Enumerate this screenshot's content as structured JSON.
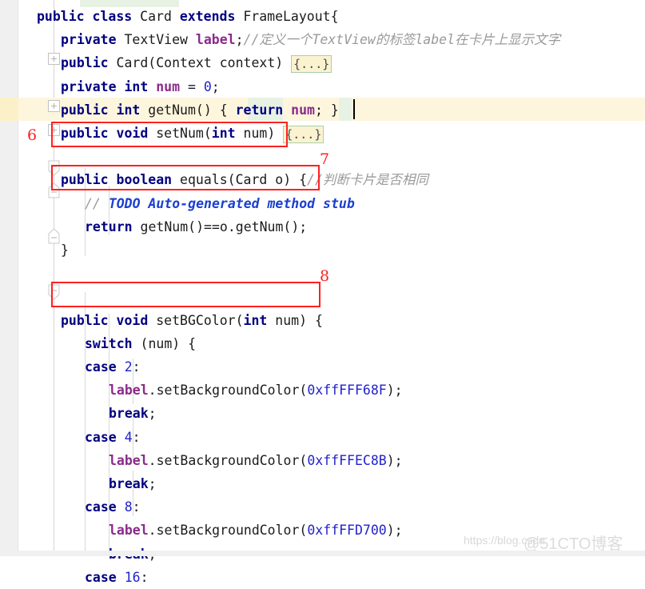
{
  "editor": {
    "language": "java",
    "class_name": "Card",
    "colors": {
      "keyword": "#000080",
      "field": "#8a2b8a",
      "number": "#2222cc",
      "comment": "#9a9a9a",
      "todo": "#1a3fd0",
      "annotation": "#ff2020",
      "current_line": "#fdf6dd",
      "fold_chip_bg": "#fbf3d0",
      "fold_chip_border": "#a8cdb0",
      "green_highlight": "#e8f2e4"
    }
  },
  "code_lines": [
    {
      "id": "line-class-decl",
      "indent": 0,
      "tokens": [
        {
          "t": "public",
          "c": "kw"
        },
        {
          "t": " ",
          "c": "punc"
        },
        {
          "t": "class",
          "c": "kw"
        },
        {
          "t": " ",
          "c": "punc"
        },
        {
          "t": "Card",
          "c": "ident"
        },
        {
          "t": " ",
          "c": "punc"
        },
        {
          "t": "extends",
          "c": "kw"
        },
        {
          "t": " ",
          "c": "punc"
        },
        {
          "t": "FrameLayout",
          "c": "ident"
        },
        {
          "t": "{",
          "c": "punc"
        }
      ]
    },
    {
      "id": "line-field-label",
      "indent": 1,
      "tokens": [
        {
          "t": "private",
          "c": "kw"
        },
        {
          "t": " ",
          "c": "punc"
        },
        {
          "t": "TextView",
          "c": "ident"
        },
        {
          "t": " ",
          "c": "punc"
        },
        {
          "t": "label",
          "c": "fld"
        },
        {
          "t": ";",
          "c": "punc"
        },
        {
          "t": "//定义一个TextView的标签label在卡片上显示文字",
          "c": "cmt"
        }
      ]
    },
    {
      "id": "line-constructor",
      "indent": 1,
      "tokens": [
        {
          "t": "public",
          "c": "kw"
        },
        {
          "t": " ",
          "c": "punc"
        },
        {
          "t": "Card",
          "c": "ident"
        },
        {
          "t": "(",
          "c": "punc"
        },
        {
          "t": "Context",
          "c": "ident"
        },
        {
          "t": " ",
          "c": "punc"
        },
        {
          "t": "context",
          "c": "ident"
        },
        {
          "t": ") ",
          "c": "punc"
        },
        {
          "t": "{...}",
          "c": "chip"
        }
      ]
    },
    {
      "id": "line-field-num",
      "indent": 1,
      "tokens": [
        {
          "t": "private",
          "c": "kw"
        },
        {
          "t": " ",
          "c": "punc"
        },
        {
          "t": "int",
          "c": "kw"
        },
        {
          "t": " ",
          "c": "punc"
        },
        {
          "t": "num",
          "c": "fld"
        },
        {
          "t": " = ",
          "c": "punc"
        },
        {
          "t": "0",
          "c": "num"
        },
        {
          "t": ";",
          "c": "punc"
        }
      ]
    },
    {
      "id": "line-getnum",
      "indent": 1,
      "tokens": [
        {
          "t": "public",
          "c": "kw"
        },
        {
          "t": " ",
          "c": "punc"
        },
        {
          "t": "int",
          "c": "kw"
        },
        {
          "t": " ",
          "c": "punc"
        },
        {
          "t": "getNum",
          "c": "ident"
        },
        {
          "t": "() ",
          "c": "punc"
        },
        {
          "t": "{ ",
          "c": "punc"
        },
        {
          "t": "return",
          "c": "kw"
        },
        {
          "t": " ",
          "c": "punc"
        },
        {
          "t": "num",
          "c": "fld"
        },
        {
          "t": "; ",
          "c": "punc"
        },
        {
          "t": "}",
          "c": "punc"
        }
      ]
    },
    {
      "id": "line-setnum",
      "indent": 1,
      "tokens": [
        {
          "t": "public",
          "c": "kw"
        },
        {
          "t": " ",
          "c": "punc"
        },
        {
          "t": "void",
          "c": "kw"
        },
        {
          "t": " ",
          "c": "punc"
        },
        {
          "t": "setNum",
          "c": "ident"
        },
        {
          "t": "(",
          "c": "punc"
        },
        {
          "t": "int",
          "c": "kw"
        },
        {
          "t": " ",
          "c": "punc"
        },
        {
          "t": "num",
          "c": "ident"
        },
        {
          "t": ") ",
          "c": "punc"
        },
        {
          "t": "{...}",
          "c": "chip"
        }
      ]
    },
    {
      "id": "line-blank-1",
      "indent": 0,
      "tokens": []
    },
    {
      "id": "line-equals",
      "indent": 1,
      "tokens": [
        {
          "t": "public",
          "c": "kw"
        },
        {
          "t": " ",
          "c": "punc"
        },
        {
          "t": "boolean",
          "c": "kw"
        },
        {
          "t": " ",
          "c": "punc"
        },
        {
          "t": "equals",
          "c": "ident"
        },
        {
          "t": "(",
          "c": "punc"
        },
        {
          "t": "Card",
          "c": "ident"
        },
        {
          "t": " ",
          "c": "punc"
        },
        {
          "t": "o",
          "c": "ident"
        },
        {
          "t": ") {",
          "c": "punc"
        },
        {
          "t": "//判断卡片是否相同",
          "c": "cmt"
        }
      ]
    },
    {
      "id": "line-todo",
      "indent": 2,
      "tokens": [
        {
          "t": "// ",
          "c": "cmt"
        },
        {
          "t": "TODO Auto-generated method stub",
          "c": "todo"
        }
      ]
    },
    {
      "id": "line-return-equals",
      "indent": 2,
      "tokens": [
        {
          "t": "return",
          "c": "kw"
        },
        {
          "t": " ",
          "c": "punc"
        },
        {
          "t": "getNum",
          "c": "ident"
        },
        {
          "t": "()==",
          "c": "punc"
        },
        {
          "t": "o",
          "c": "ident"
        },
        {
          "t": ".",
          "c": "punc"
        },
        {
          "t": "getNum",
          "c": "ident"
        },
        {
          "t": "();",
          "c": "punc"
        }
      ]
    },
    {
      "id": "line-close-equals",
      "indent": 1,
      "tokens": [
        {
          "t": "}",
          "c": "punc"
        }
      ]
    },
    {
      "id": "line-blank-2",
      "indent": 0,
      "tokens": []
    },
    {
      "id": "line-blank-3",
      "indent": 0,
      "tokens": []
    },
    {
      "id": "line-setbgcolor",
      "indent": 1,
      "tokens": [
        {
          "t": "public",
          "c": "kw"
        },
        {
          "t": " ",
          "c": "punc"
        },
        {
          "t": "void",
          "c": "kw"
        },
        {
          "t": " ",
          "c": "punc"
        },
        {
          "t": "setBGColor",
          "c": "ident"
        },
        {
          "t": "(",
          "c": "punc"
        },
        {
          "t": "int",
          "c": "kw"
        },
        {
          "t": " ",
          "c": "punc"
        },
        {
          "t": "num",
          "c": "ident"
        },
        {
          "t": ") {",
          "c": "punc"
        }
      ]
    },
    {
      "id": "line-switch",
      "indent": 2,
      "tokens": [
        {
          "t": "switch",
          "c": "kw"
        },
        {
          "t": " (",
          "c": "punc"
        },
        {
          "t": "num",
          "c": "ident"
        },
        {
          "t": ") {",
          "c": "punc"
        }
      ]
    },
    {
      "id": "line-case-2",
      "indent": 2,
      "tokens": [
        {
          "t": "case",
          "c": "kw"
        },
        {
          "t": " ",
          "c": "punc"
        },
        {
          "t": "2",
          "c": "num"
        },
        {
          "t": ":",
          "c": "punc"
        }
      ]
    },
    {
      "id": "line-setbg-2",
      "indent": 3,
      "tokens": [
        {
          "t": "label",
          "c": "fld"
        },
        {
          "t": ".",
          "c": "punc"
        },
        {
          "t": "setBackgroundColor",
          "c": "ident"
        },
        {
          "t": "(",
          "c": "punc"
        },
        {
          "t": "0xffFFF68F",
          "c": "num"
        },
        {
          "t": ");",
          "c": "punc"
        }
      ]
    },
    {
      "id": "line-break-2",
      "indent": 3,
      "tokens": [
        {
          "t": "break",
          "c": "kw"
        },
        {
          "t": ";",
          "c": "punc"
        }
      ]
    },
    {
      "id": "line-case-4",
      "indent": 2,
      "tokens": [
        {
          "t": "case",
          "c": "kw"
        },
        {
          "t": " ",
          "c": "punc"
        },
        {
          "t": "4",
          "c": "num"
        },
        {
          "t": ":",
          "c": "punc"
        }
      ]
    },
    {
      "id": "line-setbg-4",
      "indent": 3,
      "tokens": [
        {
          "t": "label",
          "c": "fld"
        },
        {
          "t": ".",
          "c": "punc"
        },
        {
          "t": "setBackgroundColor",
          "c": "ident"
        },
        {
          "t": "(",
          "c": "punc"
        },
        {
          "t": "0xffFFEC8B",
          "c": "num"
        },
        {
          "t": ");",
          "c": "punc"
        }
      ]
    },
    {
      "id": "line-break-4",
      "indent": 3,
      "tokens": [
        {
          "t": "break",
          "c": "kw"
        },
        {
          "t": ";",
          "c": "punc"
        }
      ]
    },
    {
      "id": "line-case-8",
      "indent": 2,
      "tokens": [
        {
          "t": "case",
          "c": "kw"
        },
        {
          "t": " ",
          "c": "punc"
        },
        {
          "t": "8",
          "c": "num"
        },
        {
          "t": ":",
          "c": "punc"
        }
      ]
    },
    {
      "id": "line-setbg-8",
      "indent": 3,
      "tokens": [
        {
          "t": "label",
          "c": "fld"
        },
        {
          "t": ".",
          "c": "punc"
        },
        {
          "t": "setBackgroundColor",
          "c": "ident"
        },
        {
          "t": "(",
          "c": "punc"
        },
        {
          "t": "0xffFFD700",
          "c": "num"
        },
        {
          "t": ");",
          "c": "punc"
        }
      ]
    },
    {
      "id": "line-break-8",
      "indent": 3,
      "tokens": [
        {
          "t": "break",
          "c": "kw"
        },
        {
          "t": ";",
          "c": "punc"
        }
      ]
    },
    {
      "id": "line-case-16",
      "indent": 2,
      "tokens": [
        {
          "t": "case",
          "c": "kw"
        },
        {
          "t": " ",
          "c": "punc"
        },
        {
          "t": "16",
          "c": "num"
        },
        {
          "t": ":",
          "c": "punc"
        }
      ]
    }
  ],
  "annotations": [
    {
      "id": "annotation-6",
      "label": "6"
    },
    {
      "id": "annotation-7",
      "label": "7"
    },
    {
      "id": "annotation-8",
      "label": "8"
    }
  ],
  "watermarks": {
    "url": "https://blog.csdn.",
    "blog": "@51CTO博客"
  }
}
